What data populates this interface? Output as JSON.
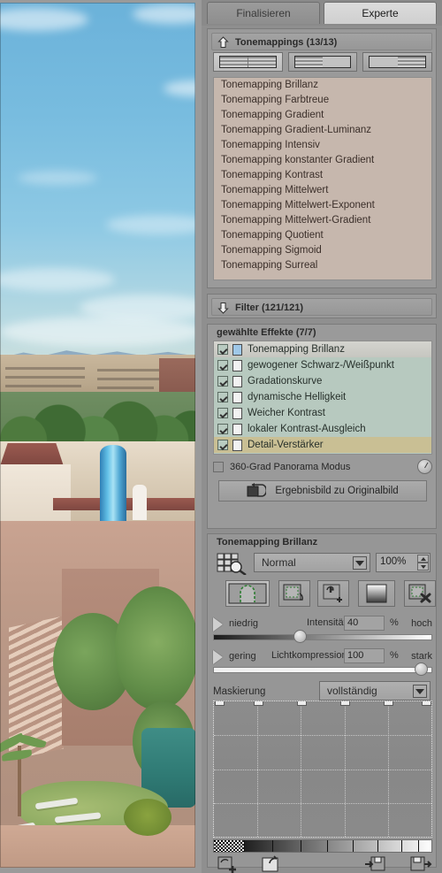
{
  "tabs": [
    {
      "label": "Finalisieren",
      "active": false
    },
    {
      "label": "Experte",
      "active": true
    }
  ],
  "tonemappings": {
    "header": "Tonemappings (13/13)",
    "header_icon": "arrow-up-icon",
    "view_buttons": [
      {
        "name": "view-mode-both",
        "selected": true
      },
      {
        "name": "view-mode-left",
        "selected": false
      },
      {
        "name": "view-mode-right",
        "selected": false
      }
    ],
    "items": [
      "Tonemapping Brillanz",
      "Tonemapping Farbtreue",
      "Tonemapping Gradient",
      "Tonemapping Gradient-Luminanz",
      "Tonemapping Intensiv",
      "Tonemapping konstanter Gradient",
      "Tonemapping Kontrast",
      "Tonemapping Mittelwert",
      "Tonemapping Mittelwert-Exponent",
      "Tonemapping Mittelwert-Gradient",
      "Tonemapping Quotient",
      "Tonemapping Sigmoid",
      "Tonemapping Surreal"
    ]
  },
  "filter": {
    "header": "Filter (121/121)",
    "header_icon": "arrow-down-icon"
  },
  "effects": {
    "label": "gewählte Effekte (7/7)",
    "rows": [
      {
        "name": "Tonemapping Brillanz",
        "checked": true,
        "icon": "page-icon-blue",
        "highlight": "selected"
      },
      {
        "name": "gewogener Schwarz-/Weißpunkt",
        "checked": true,
        "icon": "page-icon",
        "highlight": "none"
      },
      {
        "name": "Gradationskurve",
        "checked": true,
        "icon": "page-icon",
        "highlight": "none"
      },
      {
        "name": "dynamische Helligkeit",
        "checked": true,
        "icon": "page-icon",
        "highlight": "none"
      },
      {
        "name": "Weicher Kontrast",
        "checked": true,
        "icon": "page-icon",
        "highlight": "none"
      },
      {
        "name": "lokaler Kontrast-Ausgleich",
        "checked": true,
        "icon": "page-icon",
        "highlight": "none"
      },
      {
        "name": "Detail-Verstärker",
        "checked": true,
        "icon": "page-icon",
        "highlight": "active"
      }
    ]
  },
  "panorama": {
    "label": "360-Grad Panorama Modus",
    "checked": false,
    "knob_name": "rotation-knob"
  },
  "compare_button": {
    "label": "Ergebnisbild zu Originalbild",
    "icon": "compare-images-icon"
  },
  "effect_editor": {
    "title": "Tonemapping Brillanz",
    "grid_icon": "grid-magnifier-icon",
    "blend_mode": "Normal",
    "opacity": "100%",
    "toolbar": [
      {
        "name": "mask-full-button",
        "icon": "frame-mask-icon",
        "active": true
      },
      {
        "name": "mask-copy-button",
        "icon": "mask-copy-icon",
        "active": false
      },
      {
        "name": "mask-add-button",
        "icon": "mask-add-icon",
        "active": false
      },
      {
        "name": "gradient-mask-button",
        "icon": "gradient-box-icon",
        "active": false
      },
      {
        "name": "mask-delete-button",
        "icon": "mask-delete-icon",
        "active": false
      }
    ],
    "sliders": [
      {
        "name": "Intensität",
        "min_label": "niedrig",
        "max_label": "hoch",
        "value": "40",
        "unit": "%",
        "fill_percent": 40,
        "track": "dark-to-light"
      },
      {
        "name": "Lichtkompression",
        "min_label": "gering",
        "max_label": "stark",
        "value": "100",
        "unit": "%",
        "fill_percent": 97,
        "track": "light"
      }
    ],
    "mask": {
      "label": "Maskierung",
      "mode": "vollständig",
      "handle_count": 6,
      "grid_cols": 5,
      "grid_rows": 4
    },
    "bottom_icons": [
      {
        "name": "mask-new-button",
        "icon": "mask-new-icon"
      },
      {
        "name": "mask-open-button",
        "icon": "mask-open-icon"
      },
      {
        "name": "mask-save-button",
        "icon": "mask-save-icon"
      },
      {
        "name": "mask-export-button",
        "icon": "mask-export-icon"
      }
    ]
  },
  "photo": {
    "alt": "Resort-Hotel mit blauer Wasserrutsche, Pool, Palmen und Liegestühlen"
  },
  "colors": {
    "panel_bg": "#9a9a9a",
    "window_bg": "#8f8f8f",
    "tm_list_bg": "#c6b7ad",
    "effects_list_bg": "#b7c9bf",
    "effects_active_row": "#c9bf94",
    "tab_active": "#dcdcdc"
  }
}
